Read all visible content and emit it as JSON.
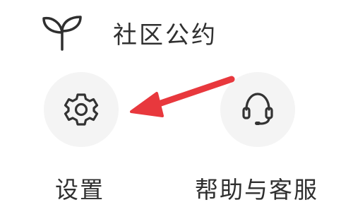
{
  "menu": {
    "community": {
      "label": "社区公约",
      "icon": "sprout-icon"
    },
    "settings": {
      "label": "设置",
      "icon": "gear-icon"
    },
    "help": {
      "label": "帮助与客服",
      "icon": "headset-icon"
    }
  },
  "annotation": {
    "type": "arrow",
    "color": "#e8383d",
    "points_to": "settings"
  },
  "colors": {
    "circle_bg": "#f4f4f4",
    "text": "#2f2f2f",
    "icon": "#333333"
  }
}
